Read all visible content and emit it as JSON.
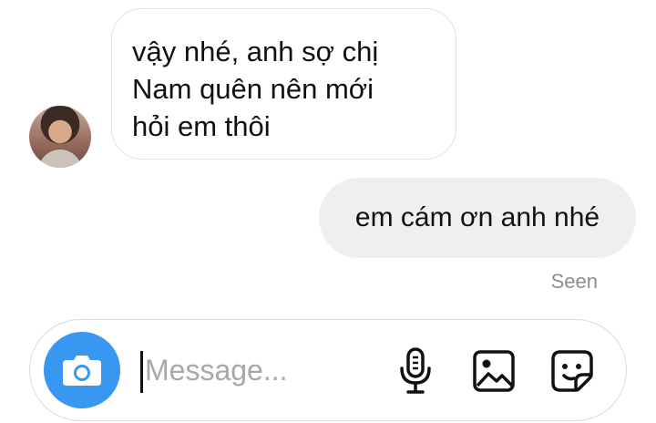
{
  "thread": {
    "incoming": {
      "lines": [
        "vậy nhé, anh sợ chị",
        "Nam quên nên mới",
        "hỏi em thôi"
      ]
    },
    "outgoing": {
      "text": "em cám ơn anh nhé"
    },
    "seen_label": "Seen"
  },
  "composer": {
    "placeholder": "Message...",
    "icons": [
      "camera-icon",
      "microphone-icon",
      "gallery-icon",
      "sticker-icon"
    ],
    "accent_color": "#3897f0"
  }
}
